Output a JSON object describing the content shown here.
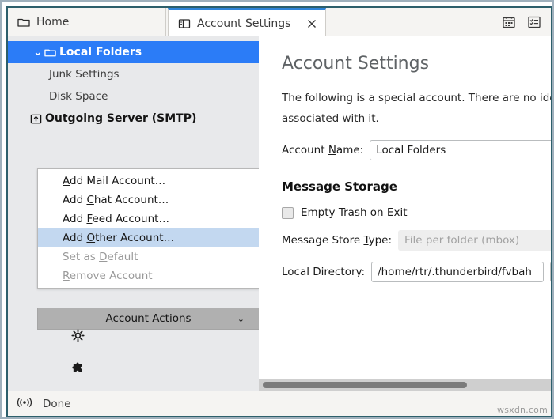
{
  "window": {
    "tabs": [
      {
        "label": "Home",
        "icon": "folder-icon",
        "active": false
      },
      {
        "label": "Account Settings",
        "icon": "account-settings-icon",
        "active": true,
        "close": "✕"
      }
    ],
    "toolbar_buttons": [
      {
        "name": "calendar-icon",
        "label": "Calendar"
      },
      {
        "name": "tasks-icon",
        "label": "Tasks"
      }
    ]
  },
  "sidebar": {
    "tree": [
      {
        "label": "Local Folders",
        "icon": "folder-icon",
        "twisty": "⌄",
        "selected": true
      },
      {
        "label": "Junk Settings",
        "selected": false
      },
      {
        "label": "Disk Space",
        "selected": false
      },
      {
        "label": "Outgoing Server (SMTP)",
        "icon": "outgoing-server-icon",
        "selected": false
      }
    ],
    "account_actions": {
      "button_label_pre": "",
      "button_accel": "A",
      "button_label_post": "ccount Actions",
      "chevron": "⌄",
      "menu_items": [
        {
          "pre": "",
          "accel": "A",
          "post": "dd Mail Account…",
          "state": "normal"
        },
        {
          "pre": "Add ",
          "accel": "C",
          "post": "hat Account…",
          "state": "normal"
        },
        {
          "pre": "Add ",
          "accel": "F",
          "post": "eed Account…",
          "state": "normal"
        },
        {
          "pre": "Add ",
          "accel": "O",
          "post": "ther Account…",
          "state": "selected"
        },
        {
          "pre": "Set as ",
          "accel": "D",
          "post": "efault",
          "state": "disabled"
        },
        {
          "pre": "",
          "accel": "R",
          "post": "emove Account",
          "state": "disabled"
        }
      ]
    },
    "footer_icons": [
      {
        "name": "settings-gear-icon"
      },
      {
        "name": "addons-puzzle-icon"
      }
    ]
  },
  "content": {
    "title": "Account Settings",
    "description": "The following is a special account. There are no identities associated with it.",
    "account_name_label_pre": "Account ",
    "account_name_label_accel": "N",
    "account_name_label_post": "ame:",
    "account_name_value": "Local Folders",
    "message_storage_heading": "Message Storage",
    "empty_trash_label_pre": "Empty Trash on E",
    "empty_trash_label_accel": "x",
    "empty_trash_label_post": "it",
    "empty_trash_checked": false,
    "message_store_label_pre": "Message Store ",
    "message_store_label_accel": "T",
    "message_store_label_post": "ype:",
    "message_store_value": "File per folder (mbox)",
    "message_store_chevron": "⌄",
    "local_directory_label": "Local Directory:",
    "local_directory_value": "/home/rtr/.thunderbird/fvbah"
  },
  "status_bar": {
    "icon": "broadcast-antenna-icon",
    "text": "Done"
  },
  "watermark": "wsxdn.com",
  "colors": {
    "selection_blue": "#2b7cf7",
    "menu_highlight": "#c3d8f0",
    "active_tab_border": "#2f84d8",
    "sidebar_bg": "#e8e9eb",
    "window_border": "#2d5f6b"
  }
}
